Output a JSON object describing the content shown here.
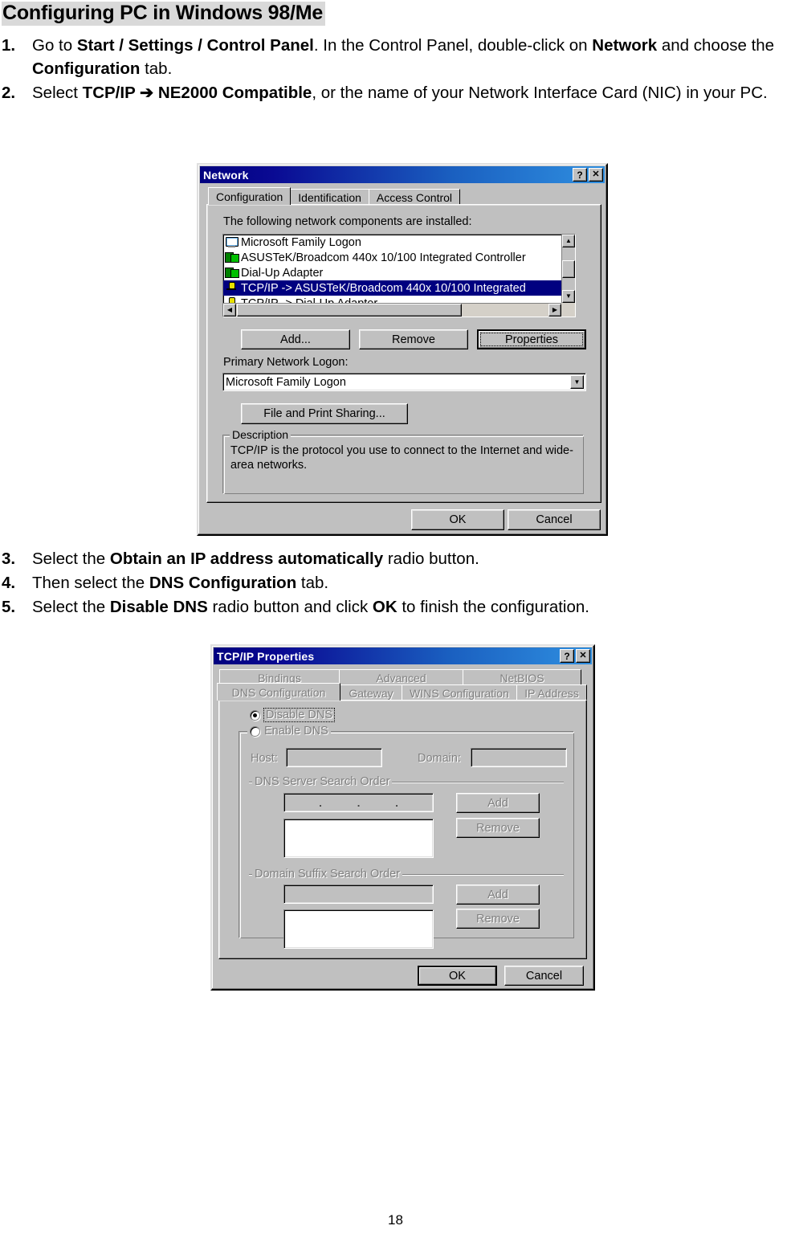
{
  "document": {
    "heading": "Configuring PC in Windows 98/Me",
    "page_number": "18",
    "steps": [
      {
        "num": "1.",
        "parts": [
          {
            "t": "Go to ",
            "b": false
          },
          {
            "t": "Start / Settings / Control Panel",
            "b": true
          },
          {
            "t": ". In the Control Panel, double-click on ",
            "b": false
          },
          {
            "t": "Network",
            "b": true
          },
          {
            "t": " and choose the ",
            "b": false
          },
          {
            "t": "Configuration",
            "b": true
          },
          {
            "t": " tab.",
            "b": false
          }
        ]
      },
      {
        "num": "2.",
        "parts": [
          {
            "t": "Select ",
            "b": false
          },
          {
            "t": "TCP/IP ➔ NE2000 Compatible",
            "b": true
          },
          {
            "t": ", or the name of your Network Interface Card (NIC) in your PC.",
            "b": false
          }
        ]
      },
      {
        "num": "3.",
        "parts": [
          {
            "t": "Select the ",
            "b": false
          },
          {
            "t": "Obtain an IP address automatically",
            "b": true
          },
          {
            "t": " radio button.",
            "b": false
          }
        ]
      },
      {
        "num": "4.",
        "parts": [
          {
            "t": "Then select the ",
            "b": false
          },
          {
            "t": "DNS Configuration",
            "b": true
          },
          {
            "t": " tab.",
            "b": false
          }
        ]
      },
      {
        "num": "5.",
        "parts": [
          {
            "t": "Select the ",
            "b": false
          },
          {
            "t": "Disable DNS",
            "b": true
          },
          {
            "t": " radio button and click ",
            "b": false
          },
          {
            "t": "OK",
            "b": true
          },
          {
            "t": " to finish the configuration.",
            "b": false
          }
        ]
      }
    ]
  },
  "network_dialog": {
    "title": "Network",
    "help_button": "?",
    "close_button": "✕",
    "tabs": [
      {
        "label": "Configuration",
        "active": true
      },
      {
        "label": "Identification",
        "active": false
      },
      {
        "label": "Access Control",
        "active": false
      }
    ],
    "components_label": "The following network components are installed:",
    "components": [
      {
        "label": "Microsoft Family Logon",
        "icon": "monitor-icon",
        "selected": false
      },
      {
        "label": "ASUSTeK/Broadcom 440x 10/100 Integrated Controller",
        "icon": "nic-icon",
        "selected": false
      },
      {
        "label": "Dial-Up Adapter",
        "icon": "nic-icon",
        "selected": false
      },
      {
        "label": "TCP/IP -> ASUSTeK/Broadcom 440x 10/100 Integrated",
        "icon": "protocol-icon",
        "selected": true
      },
      {
        "label": "TCP/IP -> Dial-Up Adapter",
        "icon": "protocol-icon",
        "selected": false
      }
    ],
    "buttons": {
      "add": "Add...",
      "remove": "Remove",
      "properties": "Properties"
    },
    "primary_logon_label": "Primary Network Logon:",
    "primary_logon_value": "Microsoft Family Logon",
    "file_print_sharing": "File and Print Sharing...",
    "description_title": "Description",
    "description_text": "TCP/IP is the protocol you use to connect to the Internet and wide-area networks.",
    "ok": "OK",
    "cancel": "Cancel"
  },
  "tcpip_dialog": {
    "title": "TCP/IP Properties",
    "help_button": "?",
    "close_button": "✕",
    "tabs_row1": [
      {
        "label": "Bindings",
        "active": false
      },
      {
        "label": "Advanced",
        "active": false
      },
      {
        "label": "NetBIOS",
        "active": false
      }
    ],
    "tabs_row2": [
      {
        "label": "DNS Configuration",
        "active": true
      },
      {
        "label": "Gateway",
        "active": false
      },
      {
        "label": "WINS Configuration",
        "active": false
      },
      {
        "label": "IP Address",
        "active": false
      }
    ],
    "disable_dns": "Disable DNS",
    "enable_dns": "Enable DNS",
    "host_label": "Host:",
    "host_value": "",
    "domain_label": "Domain:",
    "domain_value": "",
    "dns_search_title": "DNS Server Search Order",
    "dns_ip_value": "",
    "dns_list_value": "",
    "dns_add": "Add",
    "dns_remove": "Remove",
    "suffix_search_title": "Domain Suffix Search Order",
    "suffix_input_value": "",
    "suffix_list_value": "",
    "suffix_add": "Add",
    "suffix_remove": "Remove",
    "ok": "OK",
    "cancel": "Cancel"
  }
}
